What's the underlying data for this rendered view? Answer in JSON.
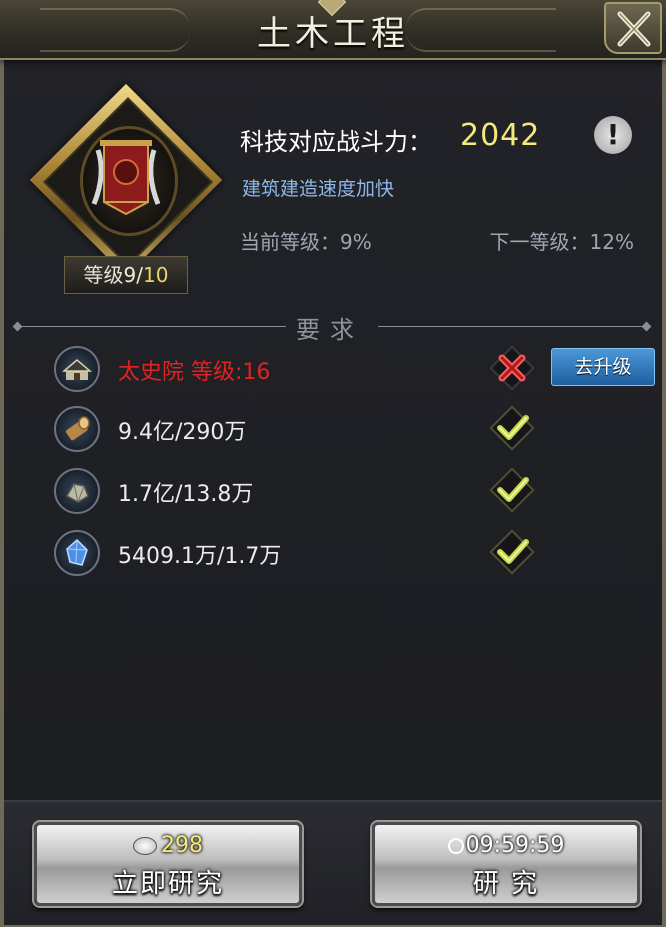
{
  "dialog": {
    "title": "土木工程"
  },
  "tech": {
    "level_prefix": "等级",
    "level_current": "9",
    "level_separator": "/",
    "level_max": "10",
    "power_label": "科技对应战斗力：",
    "power_value": "2042",
    "effect": "建筑建造速度加快",
    "current_level_text": "当前等级：9%",
    "next_level_text": "下一等级：12%"
  },
  "requirements": {
    "header": "要求",
    "items": [
      {
        "text": "太史院  等级:16",
        "status": "unmet",
        "icon": "academy-building-icon",
        "action_label": "去升级"
      },
      {
        "text": "9.4亿/290万",
        "status": "met",
        "icon": "wood-log-icon"
      },
      {
        "text": "1.7亿/13.8万",
        "status": "met",
        "icon": "iron-ore-icon"
      },
      {
        "text": "5409.1万/1.7万",
        "status": "met",
        "icon": "crystal-icon"
      }
    ]
  },
  "buttons": {
    "instant": {
      "cost": "298",
      "label": "立即研究"
    },
    "research": {
      "time": "09:59:59",
      "label": "研  究"
    }
  },
  "colors": {
    "unmet": "#e12222",
    "met_check": "#c8d84a",
    "power": "#f4e97a",
    "effect": "#8fb7e6",
    "accent_blue": "#2f78bf"
  }
}
